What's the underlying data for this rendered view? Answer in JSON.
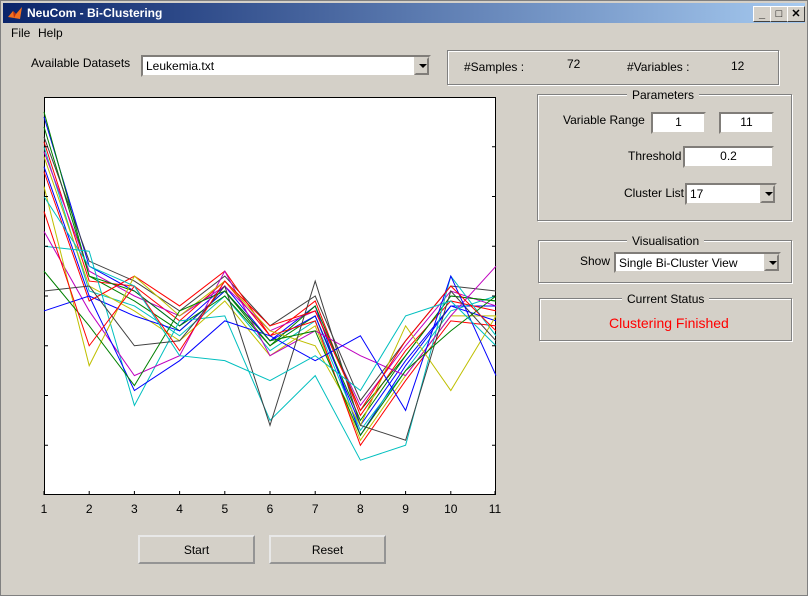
{
  "window": {
    "title": "NeuCom - Bi-Clustering",
    "controls": [
      "_",
      "□",
      "✕"
    ]
  },
  "menu": [
    "File",
    "Help"
  ],
  "datasets": {
    "label": "Available Datasets",
    "selected": "Leukemia.txt"
  },
  "info": {
    "samples_label": "#Samples :",
    "samples_value": "72",
    "variables_label": "#Variables :",
    "variables_value": "12"
  },
  "parameters": {
    "title": "Parameters",
    "variable_range_label": "Variable Range",
    "range_from": "1",
    "range_to": "11",
    "threshold_label": "Threshold",
    "threshold_value": "0.2",
    "cluster_list_label": "Cluster List",
    "cluster_list_value": "17"
  },
  "visualisation": {
    "title": "Visualisation",
    "show_label": "Show",
    "show_value": "Single Bi-Cluster View"
  },
  "status": {
    "title": "Current Status",
    "text": "Clustering Finished",
    "color": "#ff0000"
  },
  "buttons": {
    "start": "Start",
    "reset": "Reset"
  },
  "chart_data": {
    "type": "line",
    "x": [
      1,
      2,
      3,
      4,
      5,
      6,
      7,
      8,
      9,
      10,
      11
    ],
    "xlim": [
      1,
      11
    ],
    "ylim": [
      0,
      8
    ],
    "x_tick_labels": [
      "1",
      "2",
      "3",
      "4",
      "5",
      "6",
      "7",
      "8",
      "9",
      "10",
      "11"
    ],
    "grid": false,
    "series_values": [
      [
        7.6,
        4.6,
        4.1,
        3.4,
        4.2,
        3.1,
        3.8,
        1.2,
        2.6,
        3.8,
        3.8
      ],
      [
        7.4,
        4.4,
        3.9,
        3.3,
        4.1,
        3.0,
        3.6,
        1.5,
        2.8,
        4.0,
        3.9
      ],
      [
        7.1,
        4.3,
        4.2,
        3.5,
        4.3,
        3.2,
        3.9,
        1.6,
        2.9,
        3.9,
        3.7
      ],
      [
        7.0,
        4.1,
        3.8,
        3.2,
        4.0,
        2.9,
        3.5,
        1.3,
        2.5,
        3.7,
        4.0
      ],
      [
        6.9,
        4.5,
        4.0,
        3.6,
        4.2,
        3.3,
        3.7,
        1.8,
        3.0,
        4.1,
        3.8
      ],
      [
        6.8,
        4.2,
        3.7,
        3.1,
        3.9,
        2.8,
        3.4,
        1.1,
        2.4,
        3.6,
        3.6
      ],
      [
        7.2,
        4.7,
        4.3,
        3.7,
        4.4,
        3.4,
        4.0,
        1.9,
        3.1,
        4.2,
        4.1
      ],
      [
        6.6,
        4.0,
        3.6,
        3.3,
        4.1,
        3.1,
        3.6,
        1.4,
        2.7,
        3.8,
        3.5
      ],
      [
        7.7,
        4.4,
        4.1,
        3.4,
        4.0,
        3.0,
        3.8,
        1.7,
        2.8,
        4.0,
        3.9
      ],
      [
        6.5,
        3.9,
        4.4,
        3.8,
        4.5,
        3.2,
        3.5,
        1.0,
        2.3,
        3.5,
        3.4
      ],
      [
        5.0,
        4.9,
        1.8,
        3.5,
        3.6,
        1.5,
        2.4,
        0.7,
        1.0,
        4.4,
        3.2
      ],
      [
        5.3,
        3.7,
        2.4,
        2.8,
        4.5,
        2.8,
        3.3,
        2.8,
        2.4,
        3.6,
        4.6
      ],
      [
        6.2,
        2.6,
        4.4,
        3.6,
        4.3,
        3.3,
        3.0,
        1.4,
        3.4,
        2.1,
        3.6
      ],
      [
        4.1,
        4.2,
        3.0,
        3.1,
        4.2,
        1.4,
        4.3,
        1.4,
        1.1,
        4.1,
        3.1
      ],
      [
        3.7,
        4.0,
        2.1,
        2.7,
        3.5,
        3.2,
        2.7,
        3.2,
        1.7,
        4.4,
        2.4
      ],
      [
        4.5,
        3.4,
        2.2,
        3.7,
        4.1,
        3.1,
        3.3,
        1.2,
        2.5,
        3.3,
        4.0
      ],
      [
        5.7,
        3.0,
        4.2,
        2.9,
        4.3,
        3.4,
        3.7,
        1.7,
        3.1,
        4.2,
        3.3
      ],
      [
        6.0,
        4.6,
        4.2,
        2.8,
        2.7,
        2.3,
        2.8,
        2.1,
        3.6,
        3.9,
        3.0
      ]
    ]
  }
}
